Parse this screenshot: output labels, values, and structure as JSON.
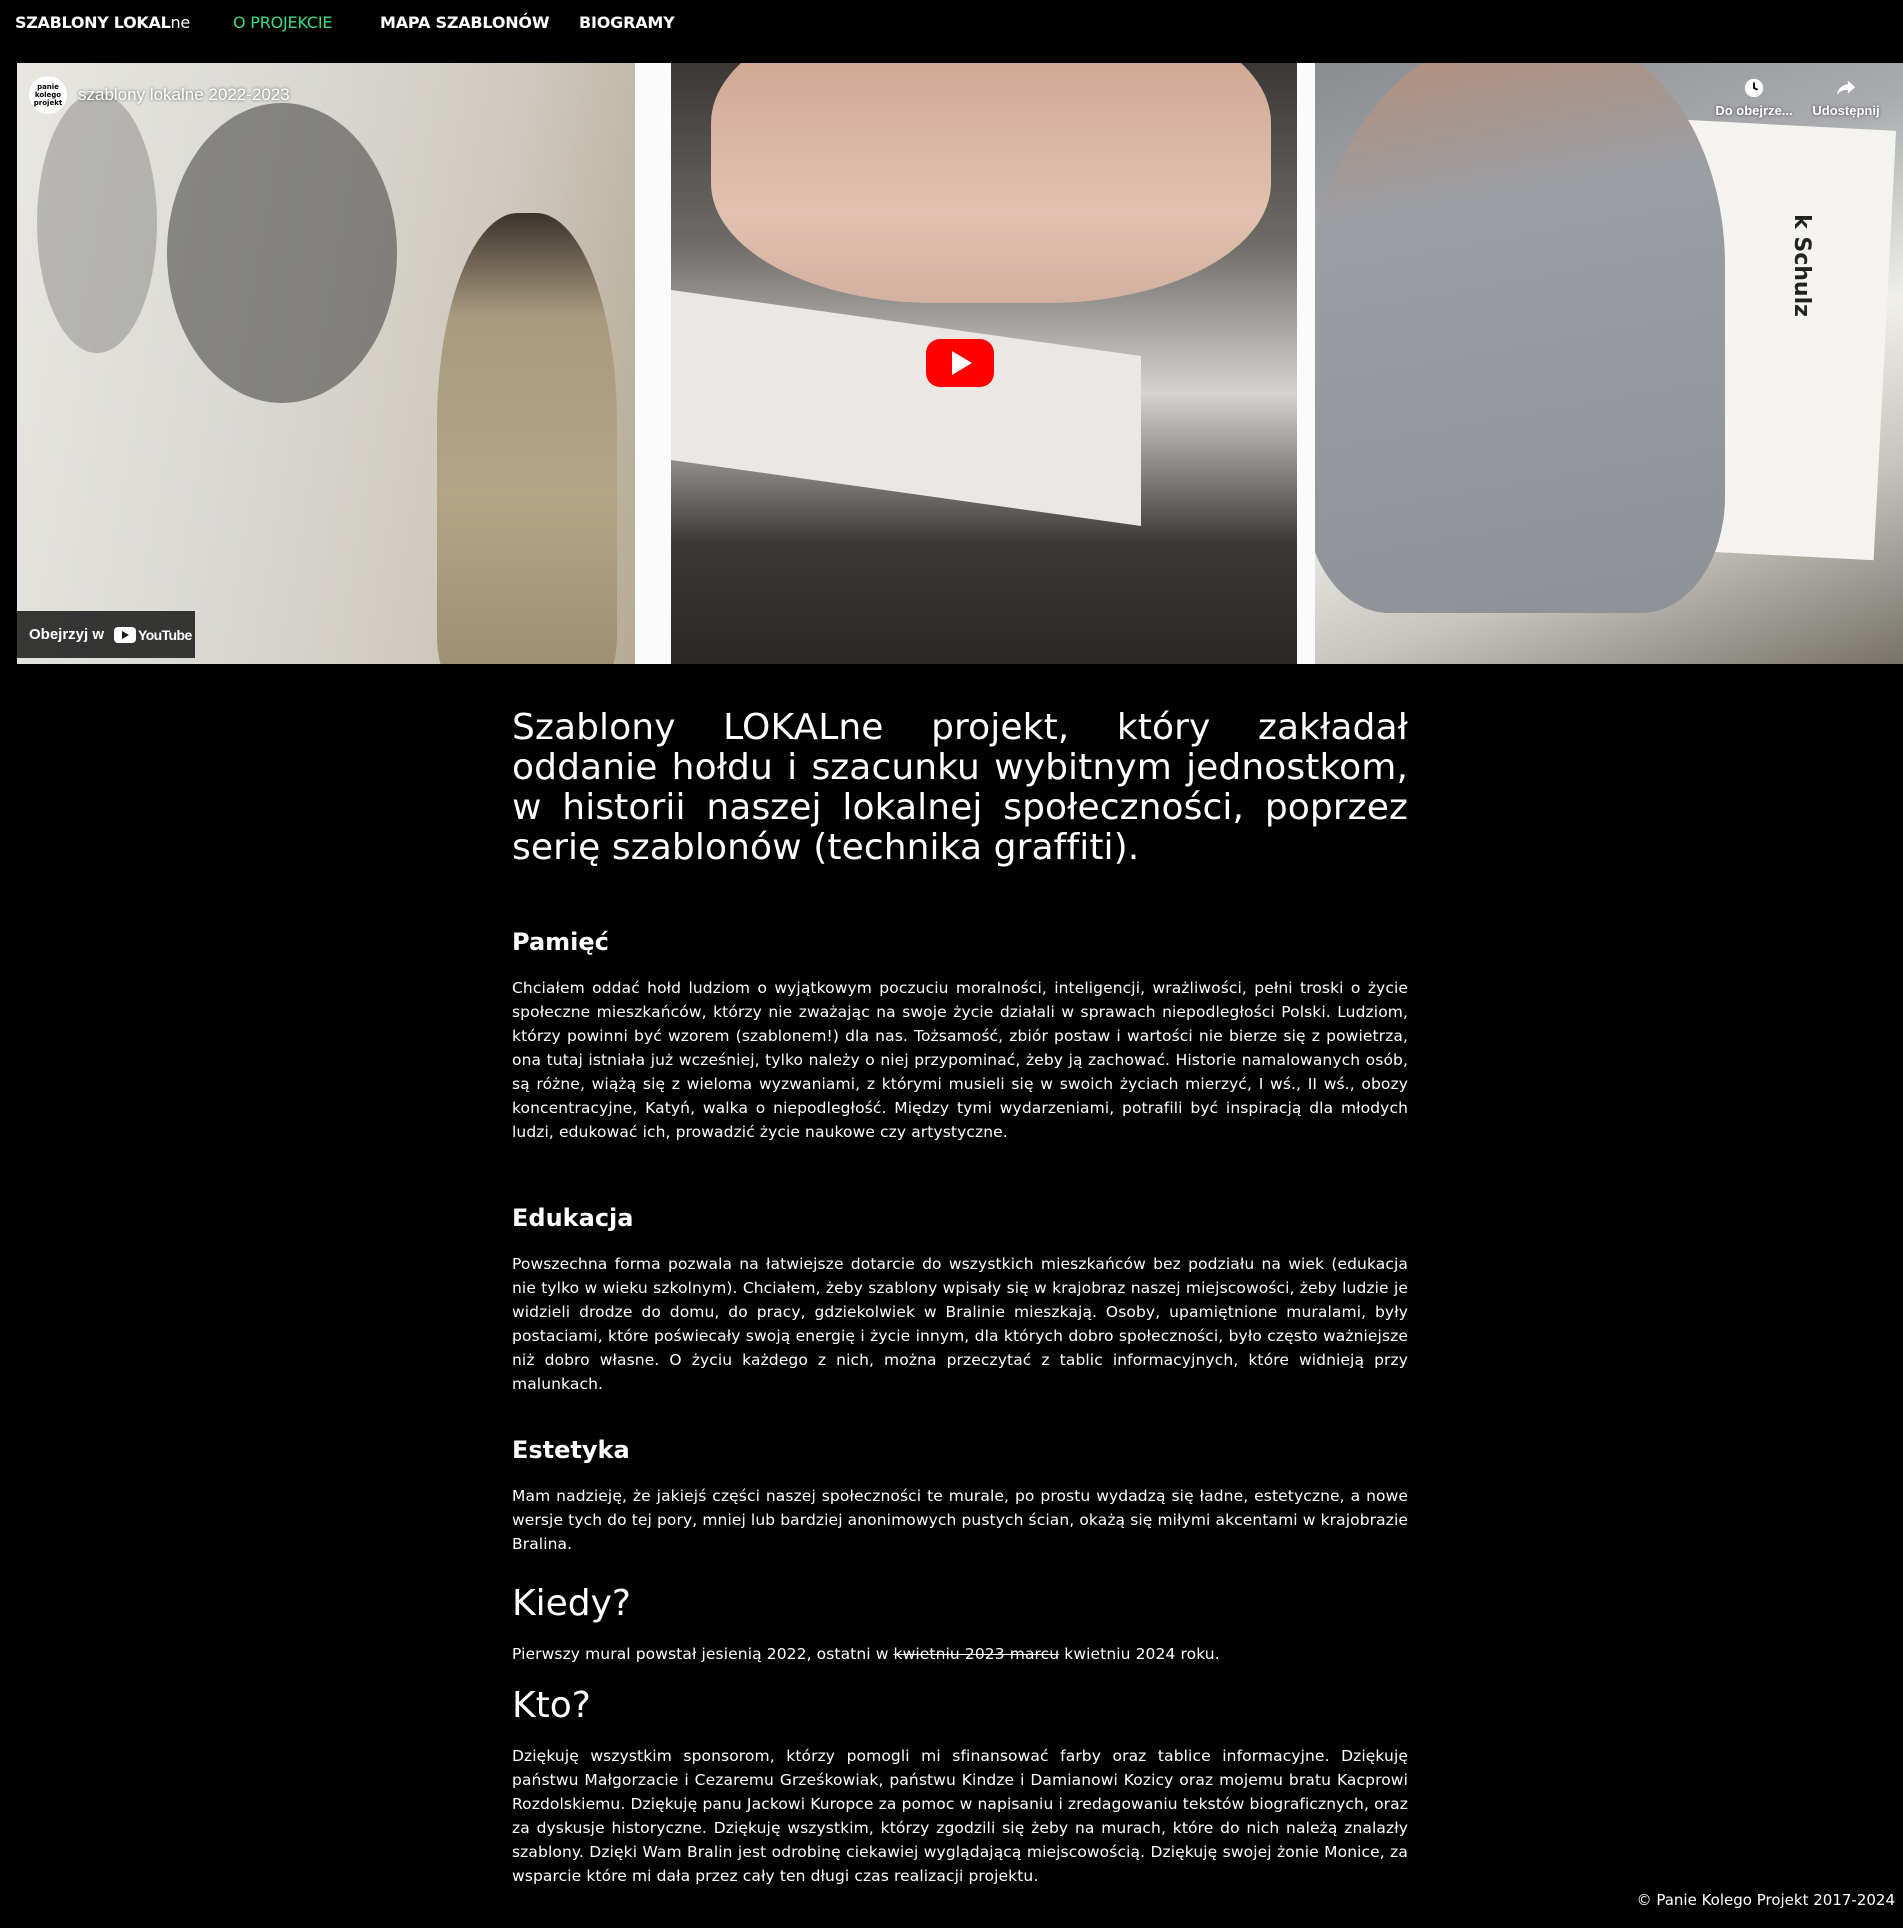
{
  "brand": {
    "part1": "SZABLONY ",
    "part2": "LOKAL",
    "part3": "ne"
  },
  "nav": [
    {
      "label": "O PROJEKCIE",
      "active": true
    },
    {
      "label": "MAPA SZABLONÓW",
      "active": false
    },
    {
      "label": "BIOGRAMY",
      "active": false
    }
  ],
  "colors": {
    "accent": "#3ddc84",
    "background": "#000000",
    "youtube_red": "#ff0000"
  },
  "video": {
    "channel_logo_text": [
      "panie",
      "kolego",
      "projekt"
    ],
    "title": "szablony lokalne 2022-2023",
    "watch_later": "Do obejrze...",
    "share": "Udostępnij",
    "watch_on": "Obejrzyj w",
    "youtube_label": "YouTube",
    "poster_text": "k Schulz"
  },
  "intro": "Szablony LOKALne projekt, który zakładał oddanie hołdu i szacunku wybitnym jednostkom, w historii naszej lokalnej społeczności, poprzez serię szablonów (technika graffiti).",
  "sections": [
    {
      "heading": "Pamięć",
      "text": "Chciałem oddać hołd ludziom o wyjątkowym poczuciu moralności, inteligencji, wrażliwości, pełni troski o życie społeczne mieszkańców, którzy nie zważając na swoje życie działali w sprawach niepodległości Polski. Ludziom, którzy powinni być wzorem (szablonem!) dla nas. Tożsamość, zbiór postaw i wartości nie bierze się z powietrza, ona tutaj istniała już wcześniej, tylko należy o niej przypominać, żeby ją zachować. Historie namalowanych osób, są różne, wiążą się z wieloma wyzwaniami, z którymi musieli się w swoich życiach mierzyć, I wś., II wś., obozy koncentracyjne, Katyń, walka o niepodległość. Między tymi wydarzeniami, potrafili być inspiracją dla młodych ludzi, edukować ich, prowadzić życie naukowe czy artystyczne."
    },
    {
      "heading": "Edukacja",
      "text": "Powszechna forma pozwala na łatwiejsze dotarcie do wszystkich mieszkańców bez podziału na wiek (edukacja nie tylko w wieku szkolnym). Chciałem, żeby szablony wpisały się w krajobraz naszej miejscowości, żeby ludzie je widzieli drodze do domu, do pracy, gdziekolwiek w Bralinie mieszkają. Osoby, upamiętnione muralami, były postaciami, które poświecały swoją energię i życie innym, dla których dobro społeczności, było często ważniejsze niż dobro własne. O życiu każdego z nich, można przeczytać z tablic informacyjnych, które widnieją przy malunkach."
    },
    {
      "heading": "Estetyka",
      "text": "Mam nadzieję, że jakiejś części naszej społeczności te murale, po prostu wydadzą się ładne, estetyczne, a nowe wersje tych do tej pory, mniej lub bardziej anonimowych pustych ścian, okażą się miłymi akcentami w krajobrazie Bralina."
    }
  ],
  "when": {
    "heading": "Kiedy?",
    "text_before": "Pierwszy mural powstał jesienią 2022, ostatni w ",
    "struck": "kwietniu 2023 marcu",
    "text_after": " kwietniu 2024 roku."
  },
  "who": {
    "heading": "Kto?",
    "text": "Dziękuję wszystkim sponsorom, którzy pomogli mi sfinansować farby oraz tablice informacyjne. Dziękuję państwu Małgorzacie i Cezaremu Grześkowiak, państwu Kindze i Damianowi Kozicy oraz mojemu bratu Kacprowi Rozdolskiemu. Dziękuję panu Jackowi Kuropce za pomoc w napisaniu i zredagowaniu tekstów biograficznych, oraz za dyskusje historyczne. Dziękuję wszystkim, którzy zgodzili się żeby na murach, które do nich należą znalazły szablony. Dzięki Wam Bralin jest odrobinę ciekawiej wyglądającą miejscowością. Dziękuję swojej żonie Monice, za wsparcie które mi dała przez cały ten długi czas realizacji projektu."
  },
  "footer": "© Panie Kolego Projekt 2017-2024"
}
